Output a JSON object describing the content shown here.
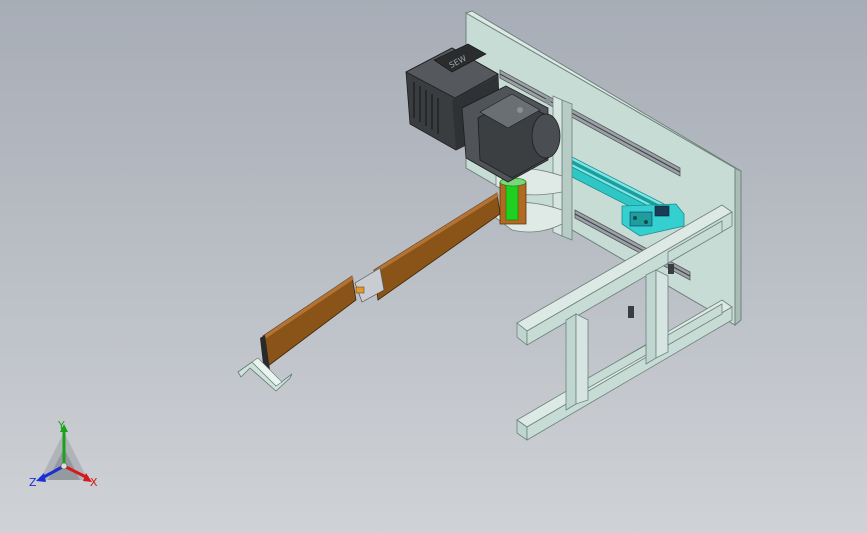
{
  "view": {
    "background_top": "#a7adb6",
    "background_bottom": "#cfd2d6"
  },
  "colors": {
    "plate": "#c8dcd6",
    "plate_edge": "#6f827c",
    "frame": "#bfd6d0",
    "motor": "#3a3d40",
    "gearbox": "#505458",
    "slide": "#2fc6c6",
    "arm": "#8a5418",
    "clamp": "#20d020",
    "rail": "#8d949a"
  },
  "motor_label": "SEW",
  "triad": {
    "x_label": "X",
    "y_label": "Y",
    "z_label": "Z",
    "x_color": "#d41a1a",
    "y_color": "#1aa31a",
    "z_color": "#1a2fd4"
  }
}
